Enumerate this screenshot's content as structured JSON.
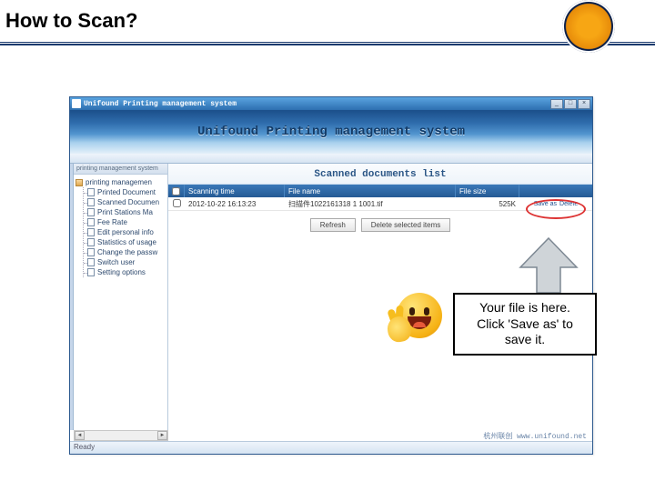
{
  "slide": {
    "title": "How to Scan?"
  },
  "window": {
    "title": "Unifound Printing management system",
    "banner": "Unifound Printing management system",
    "status": "Ready",
    "footer_brand": "杭州联创 www.unifound.net"
  },
  "sidebar": {
    "header": "printing management system",
    "root": "printing managemen",
    "items": [
      "Printed Document",
      "Scanned Documen",
      "Print Stations Ma",
      "Fee Rate",
      "Edit personal info",
      "Statistics of usage",
      "Change the passw",
      "Switch user",
      "Setting options"
    ]
  },
  "main": {
    "heading": "Scanned documents list",
    "columns": {
      "time": "Scanning time",
      "name": "File name",
      "size": "File size"
    },
    "rows": [
      {
        "time": "2012-10-22 16:13:23",
        "name": "扫描件1022161318 1 1001.tif",
        "size": "525K",
        "save_as": "Save as",
        "delete": "Delete"
      }
    ],
    "buttons": {
      "refresh": "Refresh",
      "delete_selected": "Delete selected items"
    }
  },
  "callout": {
    "line1": "Your file is here.",
    "line2": "Click 'Save as' to",
    "line3": "save it."
  }
}
